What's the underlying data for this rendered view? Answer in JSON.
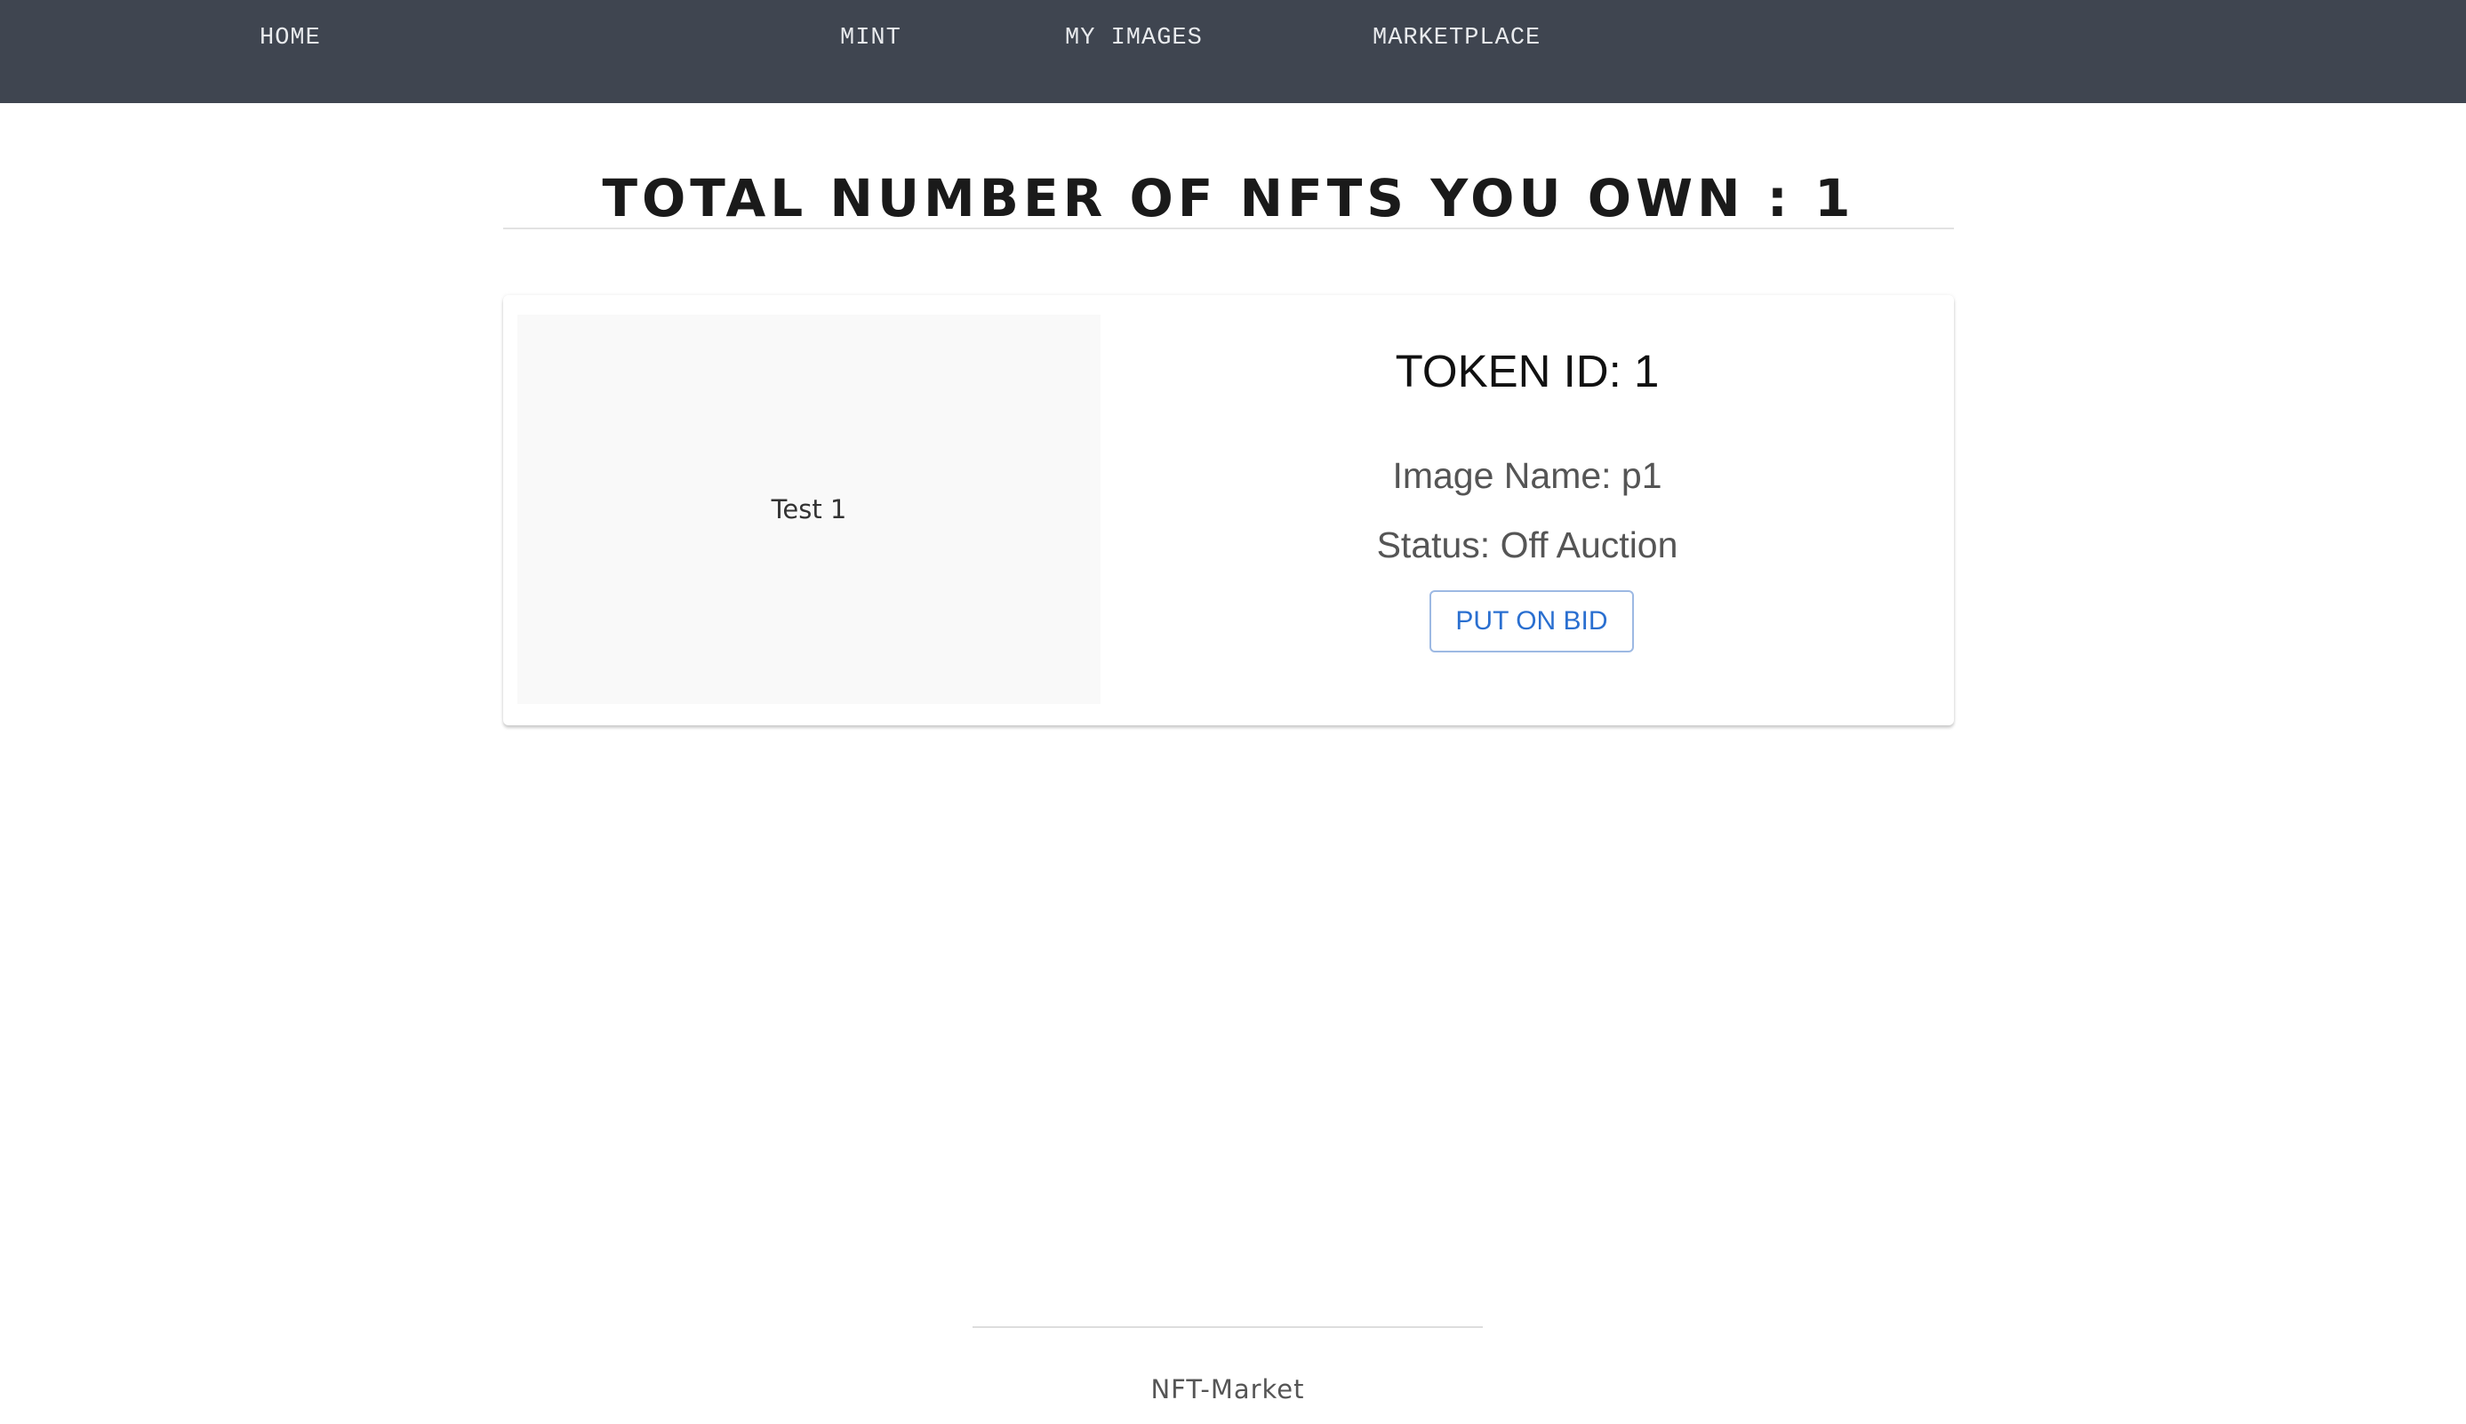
{
  "nav": {
    "items": [
      {
        "label": "HOME"
      },
      {
        "label": "MINT"
      },
      {
        "label": "MY IMAGES"
      },
      {
        "label": "MARKETPLACE"
      }
    ]
  },
  "page": {
    "title": "TOTAL NUMBER OF NFTS YOU OWN : 1"
  },
  "nft_card": {
    "image_label": "Test 1",
    "token_id": "TOKEN ID: 1",
    "image_name": "Image Name: p1",
    "status": "Status: Off Auction",
    "button_label": "PUT ON BID"
  },
  "footer": {
    "text": "NFT-Market"
  },
  "colors": {
    "nav_background": "#3f4550",
    "button_accent": "#2a6fd0",
    "button_border": "#9db9e3"
  }
}
